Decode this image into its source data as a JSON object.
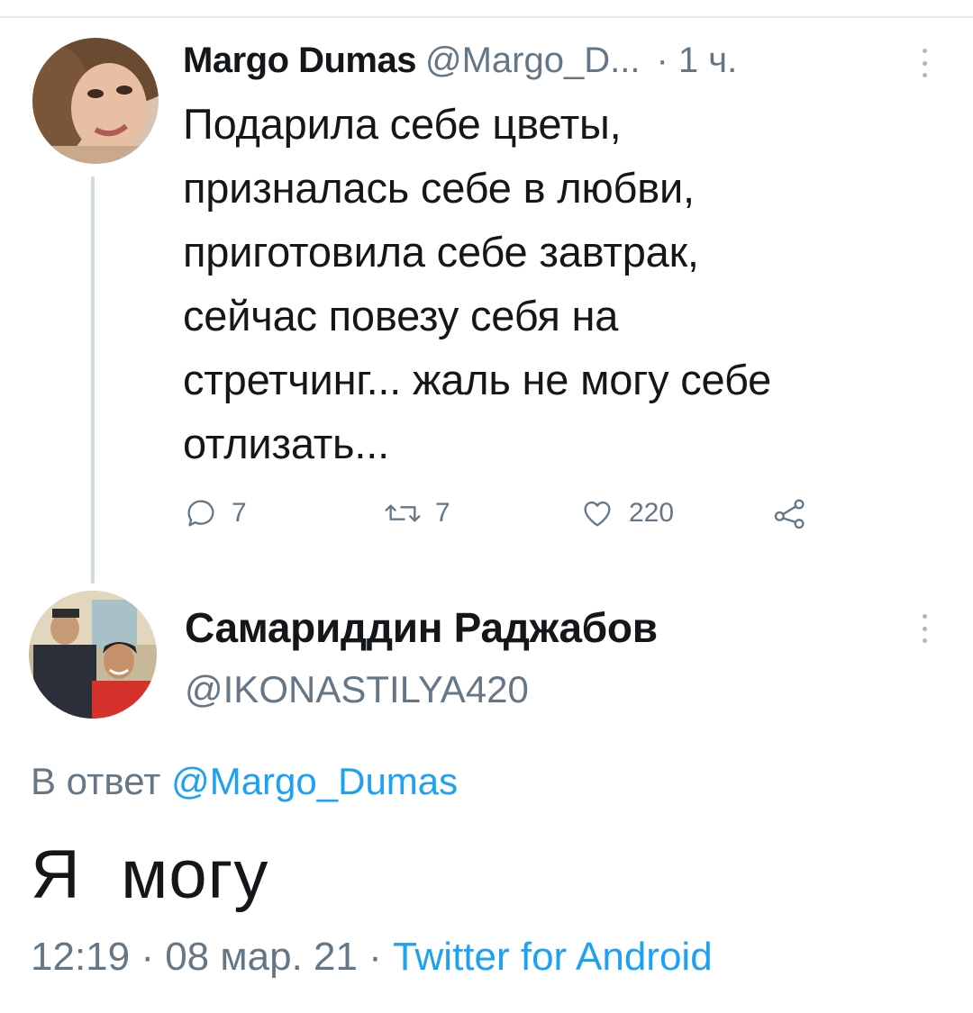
{
  "tweet": {
    "author_name": "Margo Dumas",
    "author_handle": "@Margo_D...",
    "time_ago": "· 1 ч.",
    "text": "Подарила себе цветы,\nпризналась себе в любви,\nприготовила себе завтрак,\nсейчас повезу себя на\nстретчинг... жаль не могу себе\nотлизать...",
    "actions": {
      "replies": "7",
      "retweets": "7",
      "likes": "220"
    }
  },
  "reply": {
    "author_name": "Самариддин Раджабов",
    "author_handle": "@IKONASTILYA420",
    "reply_prefix": "В ответ",
    "reply_mention": "@Margo_Dumas",
    "text": "Я  могу",
    "timestamp": "12:19 · 08 мар. 21 · ",
    "source": "Twitter for Android"
  },
  "icons": {
    "reply": "comment-icon",
    "retweet": "retweet-icon",
    "like": "heart-icon",
    "share": "share-icon",
    "more": "more-vertical-icon"
  },
  "colors": {
    "text": "#14171a",
    "secondary": "#657786",
    "link": "#1da1f2",
    "thread_line": "#cfd9de"
  }
}
